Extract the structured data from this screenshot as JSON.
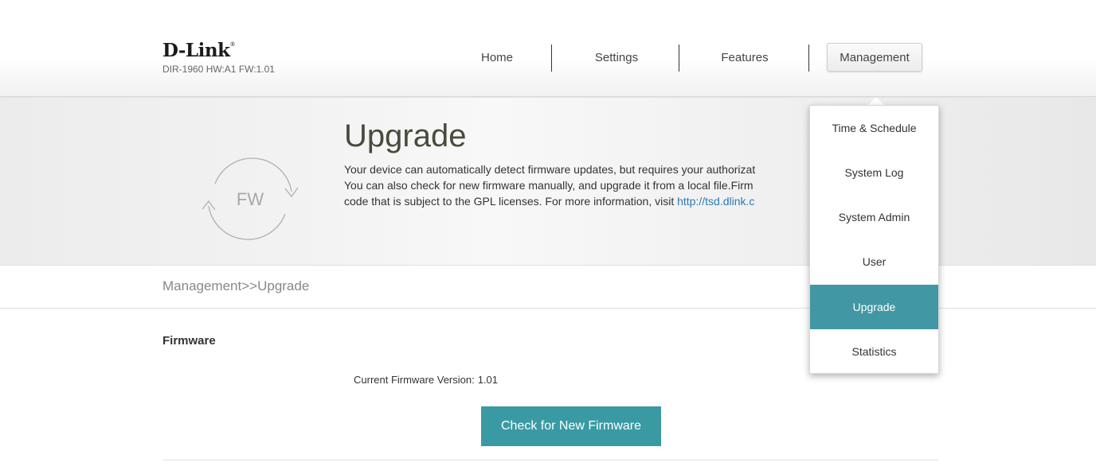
{
  "brand": {
    "logo": "D-Link",
    "registered": "®",
    "model": "DIR-1960 HW:A1 FW:1.01"
  },
  "nav": {
    "items": [
      {
        "label": "Home"
      },
      {
        "label": "Settings"
      },
      {
        "label": "Features"
      },
      {
        "label": "Management",
        "active": true
      }
    ]
  },
  "banner": {
    "icon_text": "FW",
    "title": "Upgrade",
    "desc_line1": "Your device can automatically detect firmware updates, but requires your authorizat",
    "desc_line2": "You can also check for new firmware manually, and upgrade it from a local file.Firm",
    "desc_line3": "code that is subject to the GPL licenses. For more information, visit ",
    "desc_link": "http://tsd.dlink.c"
  },
  "breadcrumb": "Management>>Upgrade",
  "firmware": {
    "section_title": "Firmware",
    "version_label": "Current Firmware Version:",
    "version_value": "1.01",
    "check_button": "Check for New Firmware"
  },
  "dropdown": {
    "items": [
      {
        "label": "Time & Schedule"
      },
      {
        "label": "System Log"
      },
      {
        "label": "System Admin"
      },
      {
        "label": "User"
      },
      {
        "label": "Upgrade",
        "active": true
      },
      {
        "label": "Statistics"
      }
    ]
  },
  "colors": {
    "accent": "#3a9aa4",
    "menu_active": "#4197a3",
    "link": "#2a7ab0"
  }
}
